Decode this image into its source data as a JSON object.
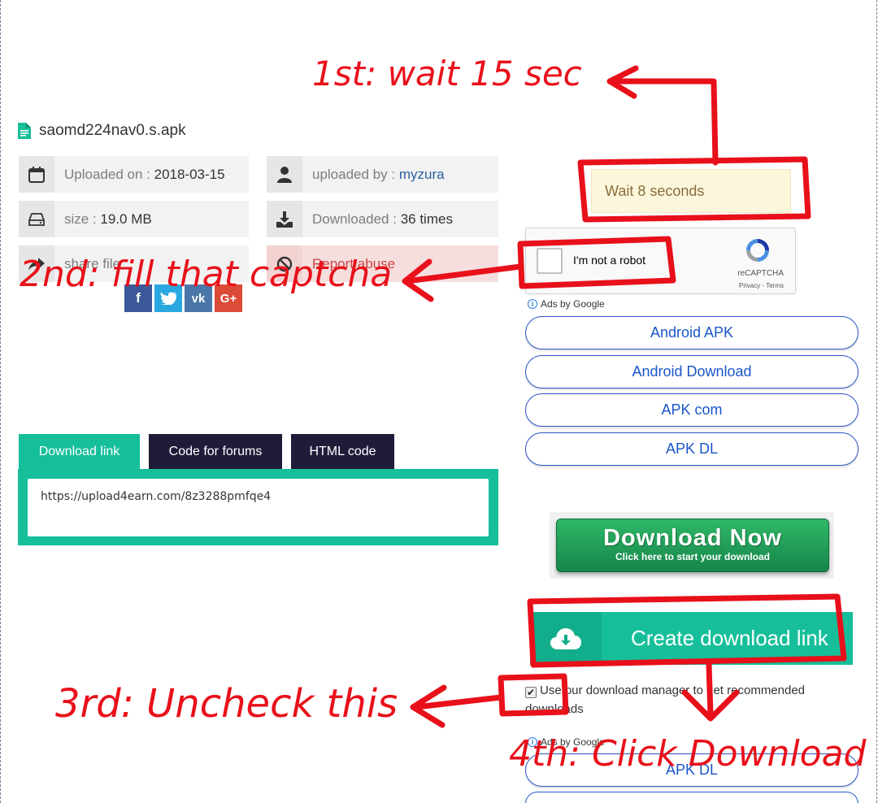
{
  "file": {
    "name": "saomd224nav0.s.apk"
  },
  "info": {
    "uploaded_on_label": "Uploaded on :",
    "uploaded_on_value": "2018-03-15",
    "uploaded_by_label": "uploaded by :",
    "uploaded_by_value": "myzura",
    "size_label": "size :",
    "size_value": "19.0 MB",
    "downloaded_label": "Downloaded :",
    "downloaded_value": "36 times",
    "share_label": "share file :",
    "report_label": "Report abuse"
  },
  "social": [
    "f",
    "t",
    "vk",
    "G+"
  ],
  "tabs": [
    {
      "label": "Download link",
      "active": true
    },
    {
      "label": "Code for forums",
      "active": false
    },
    {
      "label": "HTML code",
      "active": false
    }
  ],
  "code_box": {
    "value": "https://upload4earn.com/8z3288pmfqe4"
  },
  "wait": {
    "text": "Wait 8 seconds"
  },
  "recaptcha": {
    "label": "I'm not a robot",
    "brand": "reCAPTCHA",
    "terms": "Privacy - Terms"
  },
  "ads": {
    "by_google": "Ads by Google",
    "links": [
      "Android APK",
      "Android Download",
      "APK com",
      "APK DL"
    ],
    "bottom_link": "APK DL"
  },
  "download_now": {
    "title": "Download Now",
    "subtitle": "Click here to start your download"
  },
  "create_link": {
    "label": "Create download link"
  },
  "manager": {
    "text": "Use our download manager to get recommended downloads",
    "checked": true
  },
  "annotations": {
    "step1": "1st: wait 15 sec",
    "step2": "2nd: fill that captcha",
    "step3": "3rd: Uncheck this",
    "step4": "4th: Click Download"
  },
  "colors": {
    "accent": "#16bf9a",
    "dark_tab": "#1f1c3a",
    "annotation": "#e8101a",
    "link": "#1a55c8"
  }
}
